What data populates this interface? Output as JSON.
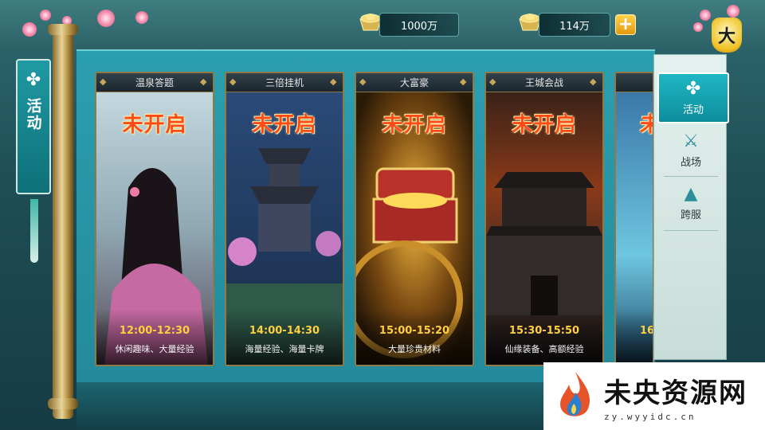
{
  "currencies": [
    {
      "amount": "1000万",
      "icon": "gold-ingot-icon"
    },
    {
      "amount": "114万",
      "icon": "gold-ingot-icon"
    }
  ],
  "add_currency": {
    "label": "+"
  },
  "lantern": {
    "label": "大"
  },
  "left_tab": {
    "label": "活动",
    "emblem": "clover-emblem-icon"
  },
  "events": [
    {
      "title": "温泉答题",
      "status": "未开启",
      "time": "12:00-12:30",
      "desc": "休闲趣味、大量经验"
    },
    {
      "title": "三倍挂机",
      "status": "未开启",
      "time": "14:00-14:30",
      "desc": "海量经验、海量卡牌"
    },
    {
      "title": "大富豪",
      "status": "未开启",
      "time": "15:00-15:20",
      "desc": "大量珍贵材料"
    },
    {
      "title": "王城会战",
      "status": "未开启",
      "time": "15:30-15:50",
      "desc": "仙缘装备、高额经验"
    },
    {
      "title": "",
      "status": "未",
      "time": "16",
      "desc": ""
    }
  ],
  "categories": [
    {
      "label": "活动",
      "icon": "clover-icon",
      "active": true
    },
    {
      "label": "战场",
      "icon": "crossed-swords-icon",
      "active": false
    },
    {
      "label": "跨服",
      "icon": "mountain-icon",
      "active": false
    }
  ],
  "watermark": {
    "title": "未央资源网",
    "subtitle": "zy.wyyidc.cn"
  },
  "colors": {
    "status": "#ff4a1a",
    "time": "#ffcf3f",
    "accent": "#1fb7c4"
  }
}
